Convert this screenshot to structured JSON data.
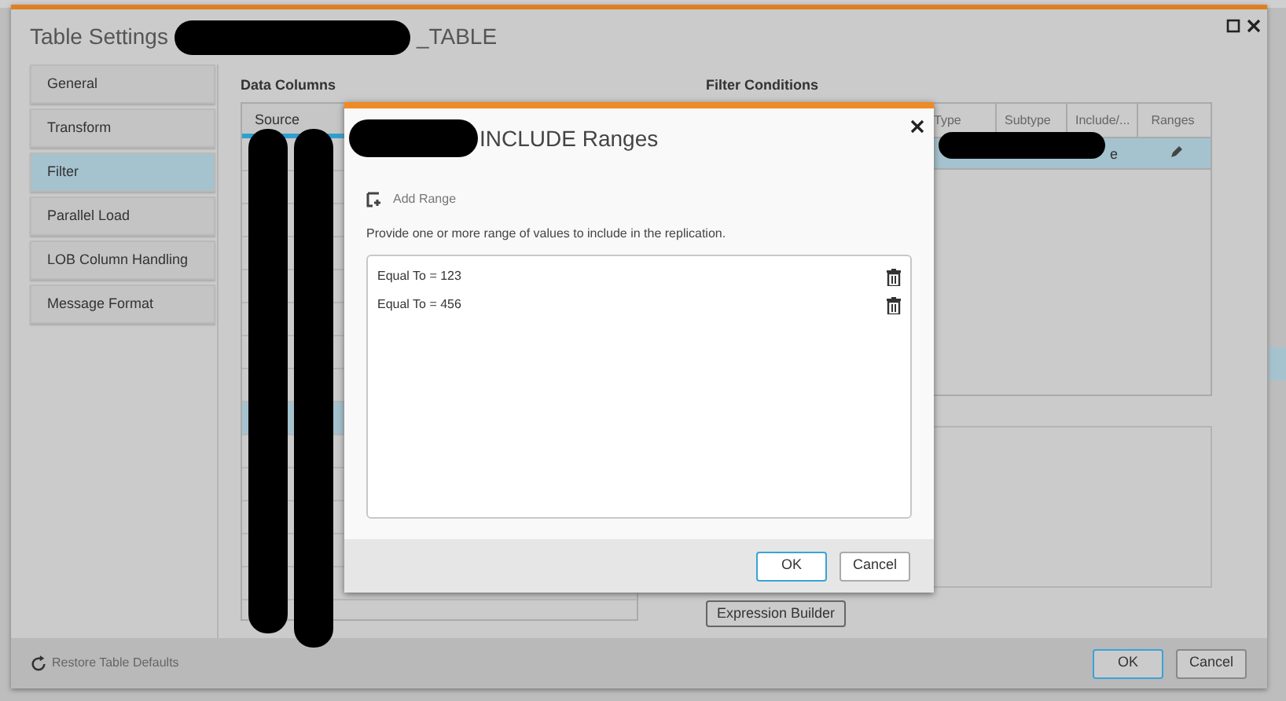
{
  "window": {
    "title": "Table Settings",
    "title_tail": "_TABLE",
    "title_redacted": true
  },
  "sidebar": {
    "items": [
      {
        "label": "General",
        "selected": false
      },
      {
        "label": "Transform",
        "selected": false
      },
      {
        "label": "Filter",
        "selected": true
      },
      {
        "label": "Parallel Load",
        "selected": false
      },
      {
        "label": "LOB Column Handling",
        "selected": false
      },
      {
        "label": "Message Format",
        "selected": false
      }
    ]
  },
  "data_columns": {
    "title": "Data Columns",
    "redacted": true,
    "columns": [
      "Source"
    ],
    "rows": [
      {
        "selected": false
      },
      {
        "selected": false
      },
      {
        "selected": false
      },
      {
        "selected": false
      },
      {
        "selected": false
      },
      {
        "selected": false
      },
      {
        "selected": false
      },
      {
        "selected": false
      },
      {
        "selected": true
      },
      {
        "selected": false
      },
      {
        "selected": false
      },
      {
        "selected": false
      },
      {
        "selected": false
      },
      {
        "selected": false
      }
    ]
  },
  "filter_conditions": {
    "title": "Filter Conditions",
    "columns": [
      "Type",
      "Subtype",
      "Include/...",
      "Ranges"
    ],
    "rows": [
      {
        "include": "e",
        "selected": true,
        "redacted": true
      }
    ],
    "expression_button": "Expression Builder"
  },
  "footer": {
    "restore_link": "Restore Table Defaults",
    "buttons": [
      "OK",
      "Cancel"
    ]
  },
  "dialog": {
    "title": "INCLUDE Ranges",
    "title_redacted": true,
    "add_range": "Add Range",
    "description": "Provide one or more range of values to include in the replication.",
    "ranges": [
      "Equal To = 123",
      "Equal To = 456"
    ],
    "buttons": [
      "OK",
      "Cancel"
    ]
  }
}
